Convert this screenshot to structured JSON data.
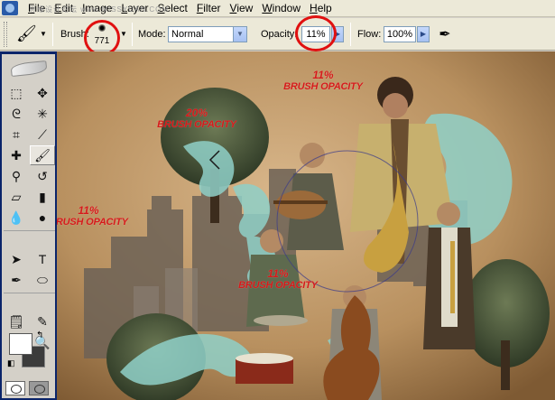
{
  "menubar": {
    "items": [
      "File",
      "Edit",
      "Image",
      "Layer",
      "Select",
      "Filter",
      "View",
      "Window",
      "Help"
    ],
    "watermark": "思缘设计论坛 www.MISSYUAN.COM"
  },
  "options": {
    "brush_label": "Brush:",
    "brush_size": "771",
    "mode_label": "Mode:",
    "mode_value": "Normal",
    "opacity_label": "Opacity:",
    "opacity_value": "11%",
    "flow_label": "Flow:",
    "flow_value": "100%"
  },
  "annotations": [
    {
      "pct": "11%",
      "caption": "BRUSH OPACITY"
    },
    {
      "pct": "20%",
      "caption": "BRUSH OPACITY"
    },
    {
      "pct": "11%",
      "caption": "BRUSH OPACITY"
    },
    {
      "pct": "11%",
      "caption": "BRUSH OPACITY"
    }
  ],
  "colors": {
    "highlight_ring": "#e01010",
    "annotation_text": "#d61a1a",
    "selection_frame": "#0a246a"
  }
}
